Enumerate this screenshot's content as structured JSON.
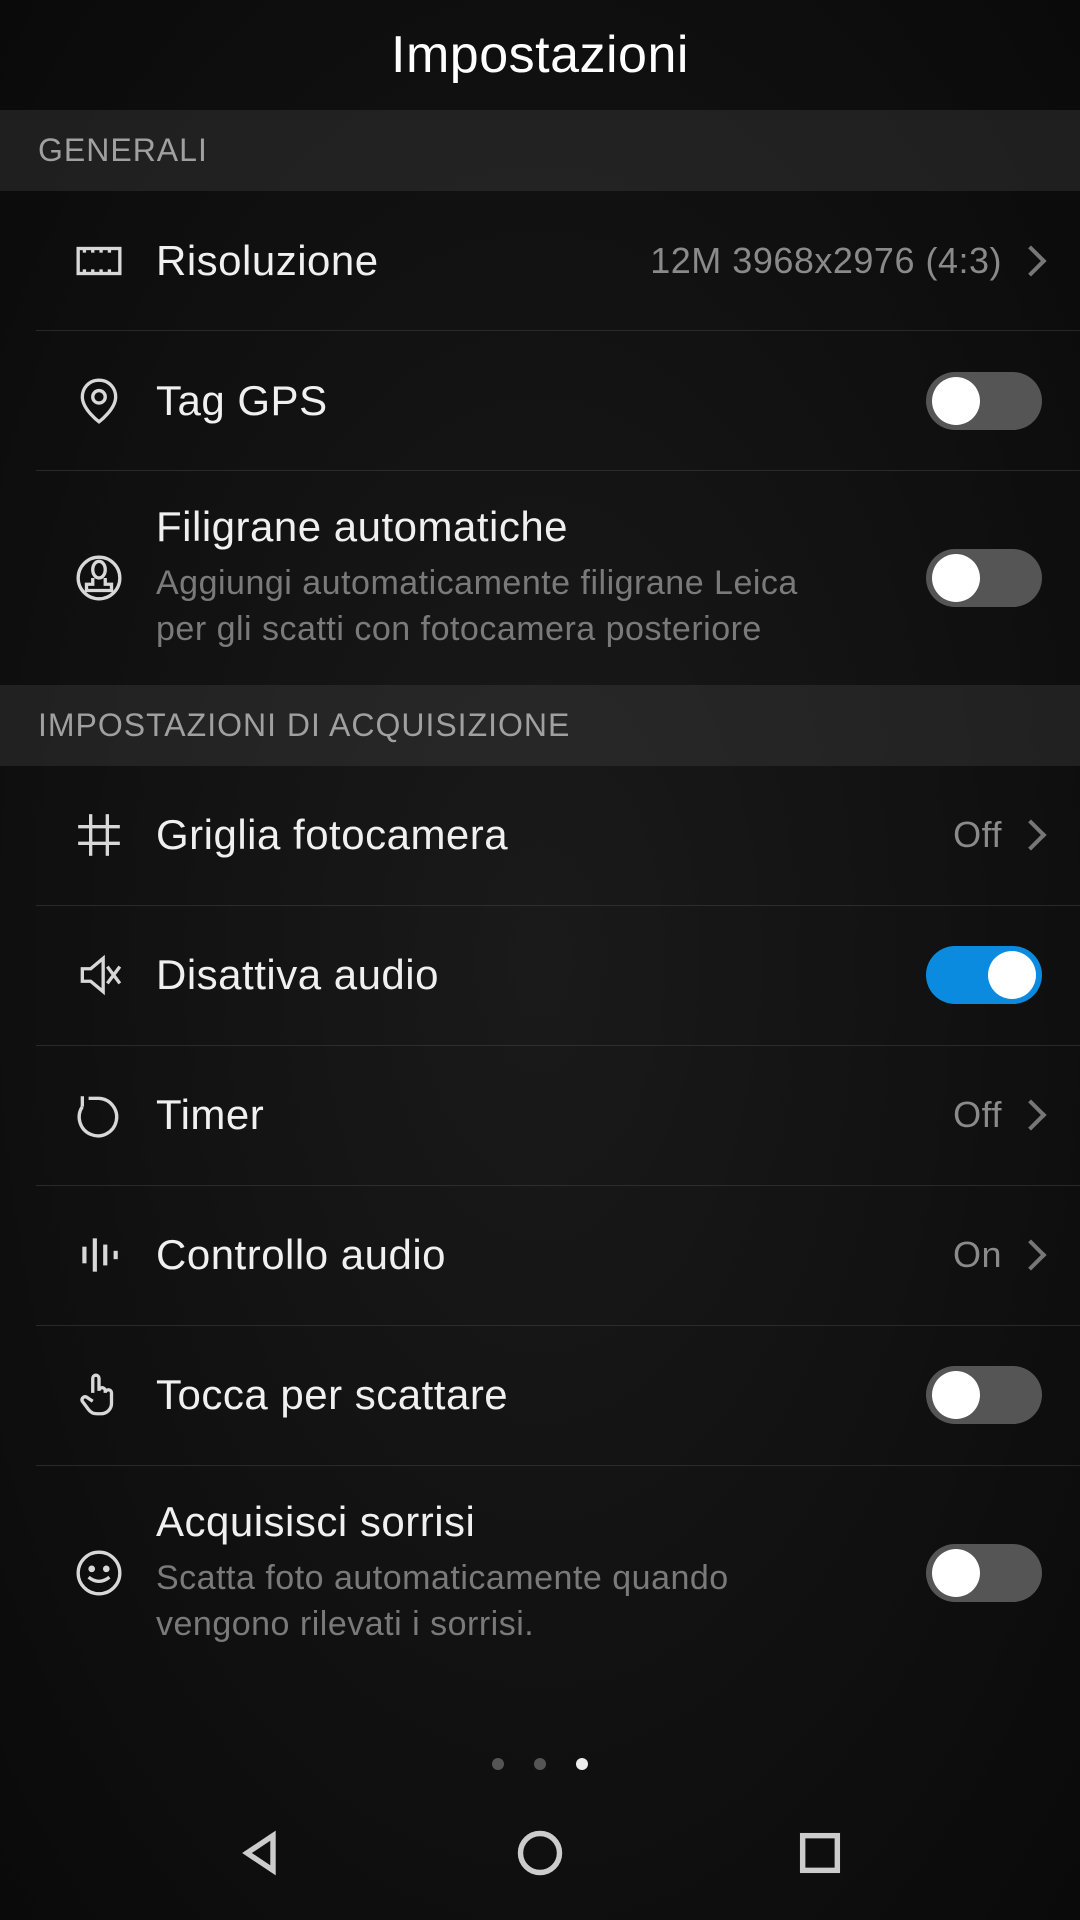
{
  "header": {
    "title": "Impostazioni"
  },
  "sections": {
    "general": {
      "label": "GENERALI"
    },
    "capture": {
      "label": "IMPOSTAZIONI DI ACQUISIZIONE"
    }
  },
  "items": {
    "resolution": {
      "title": "Risoluzione",
      "value": "12M 3968x2976 (4:3)"
    },
    "gps": {
      "title": "Tag GPS",
      "on": false
    },
    "watermark": {
      "title": "Filigrane automatiche",
      "subtitle": "Aggiungi automaticamente filigrane Leica per gli scatti con fotocamera posteriore",
      "on": false
    },
    "grid": {
      "title": "Griglia fotocamera",
      "value": "Off"
    },
    "mute": {
      "title": "Disattiva audio",
      "on": true
    },
    "timer": {
      "title": "Timer",
      "value": "Off"
    },
    "audioctrl": {
      "title": "Controllo audio",
      "value": "On"
    },
    "touchshoot": {
      "title": "Tocca per scattare",
      "on": false
    },
    "smiles": {
      "title": "Acquisisci sorrisi",
      "subtitle": "Scatta foto automaticamente quando vengono rilevati i sorrisi.",
      "on": false
    }
  }
}
